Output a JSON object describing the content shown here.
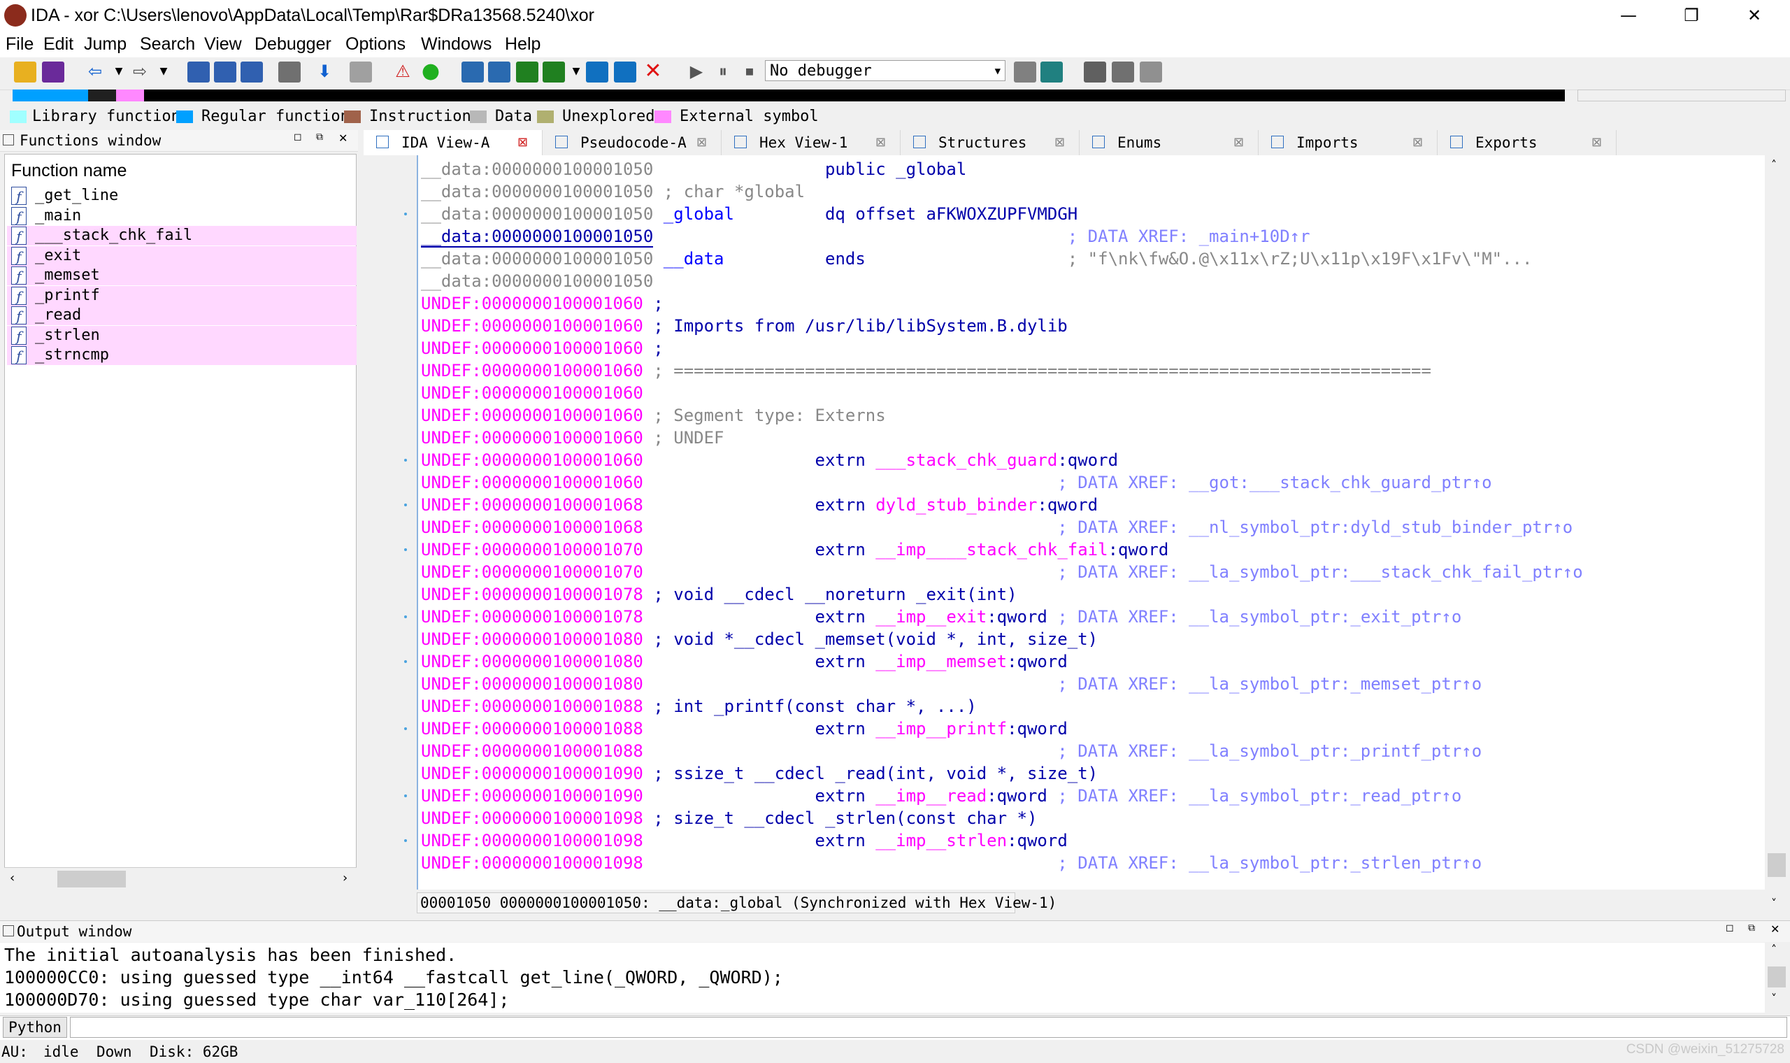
{
  "window": {
    "title": "IDA - xor C:\\Users\\lenovo\\AppData\\Local\\Temp\\Rar$DRa13568.5240\\xor",
    "minimize": "—",
    "maximize": "❐",
    "close": "✕"
  },
  "menu": [
    "File",
    "Edit",
    "Jump",
    "Search",
    "View",
    "Debugger",
    "Options",
    "Windows",
    "Help"
  ],
  "toolbar": {
    "debugger_label": "No debugger"
  },
  "legend": [
    {
      "label": "Library function",
      "color": "#a0ffff"
    },
    {
      "label": "Regular function",
      "color": "#00a0ff"
    },
    {
      "label": "Instruction",
      "color": "#a0624a"
    },
    {
      "label": "Data",
      "color": "#b8b8b8"
    },
    {
      "label": "Unexplored",
      "color": "#b0b070"
    },
    {
      "label": "External symbol",
      "color": "#ff88ff"
    }
  ],
  "functions_window": {
    "title": "Functions window",
    "column": "Function name",
    "items": [
      {
        "name": "_get_line",
        "highlight": false
      },
      {
        "name": "_main",
        "highlight": false
      },
      {
        "name": "___stack_chk_fail",
        "highlight": true
      },
      {
        "name": "_exit",
        "highlight": true
      },
      {
        "name": "_memset",
        "highlight": true
      },
      {
        "name": "_printf",
        "highlight": true
      },
      {
        "name": "_read",
        "highlight": true
      },
      {
        "name": "_strlen",
        "highlight": true
      },
      {
        "name": "_strncmp",
        "highlight": true
      }
    ]
  },
  "tabs": [
    {
      "label": "IDA View-A",
      "active": true
    },
    {
      "label": "Pseudocode-A",
      "active": false
    },
    {
      "label": "Hex View-1",
      "active": false
    },
    {
      "label": "Structures",
      "active": false
    },
    {
      "label": "Enums",
      "active": false
    },
    {
      "label": "Imports",
      "active": false
    },
    {
      "label": "Exports",
      "active": false
    }
  ],
  "disasm": [
    {
      "dot": false,
      "parts": [
        [
          "__data:0000000100001050",
          "gray"
        ],
        [
          "                 public _global",
          "navy"
        ]
      ]
    },
    {
      "dot": false,
      "parts": [
        [
          "__data:0000000100001050",
          "gray"
        ],
        [
          " ; char *global",
          "comment"
        ]
      ]
    },
    {
      "dot": true,
      "parts": [
        [
          "__data:0000000100001050",
          "gray"
        ],
        [
          " _global",
          "blue"
        ],
        [
          "         dq offset aFKWOXZUPFVMDGH",
          "navy"
        ]
      ]
    },
    {
      "dot": false,
      "parts": [
        [
          "__data:0000000100001050",
          "navy"
        ],
        [
          "                                         ; DATA XREF: _main+10D↑r",
          "xref"
        ]
      ]
    },
    {
      "dot": false,
      "parts": [
        [
          "__data:0000000100001050",
          "gray"
        ],
        [
          " __data",
          "blue"
        ],
        [
          "          ends",
          "navy"
        ],
        [
          "                    ; \"f\\nk\\fw&O.@\\x11x\\rZ;U\\x11p\\x19F\\x1Fv\\\"M\"...",
          "comment"
        ]
      ]
    },
    {
      "dot": false,
      "parts": [
        [
          "__data:0000000100001050",
          "gray"
        ]
      ]
    },
    {
      "dot": false,
      "parts": [
        [
          "UNDEF:0000000100001060",
          "magenta"
        ],
        [
          " ;",
          "navy"
        ]
      ]
    },
    {
      "dot": false,
      "parts": [
        [
          "UNDEF:0000000100001060",
          "magenta"
        ],
        [
          " ; Imports from /usr/lib/libSystem.B.dylib",
          "navy"
        ]
      ]
    },
    {
      "dot": false,
      "parts": [
        [
          "UNDEF:0000000100001060",
          "magenta"
        ],
        [
          " ;",
          "navy"
        ]
      ]
    },
    {
      "dot": false,
      "parts": [
        [
          "UNDEF:0000000100001060",
          "magenta"
        ],
        [
          " ; ===========================================================================",
          "comment"
        ]
      ]
    },
    {
      "dot": false,
      "parts": [
        [
          "UNDEF:0000000100001060",
          "magenta"
        ]
      ]
    },
    {
      "dot": false,
      "parts": [
        [
          "UNDEF:0000000100001060",
          "magenta"
        ],
        [
          " ; Segment type: Externs",
          "comment"
        ]
      ]
    },
    {
      "dot": false,
      "parts": [
        [
          "UNDEF:0000000100001060",
          "magenta"
        ],
        [
          " ; UNDEF",
          "comment"
        ]
      ]
    },
    {
      "dot": true,
      "parts": [
        [
          "UNDEF:0000000100001060",
          "magenta"
        ],
        [
          "                 extrn ",
          "navy"
        ],
        [
          "___stack_chk_guard",
          "magenta"
        ],
        [
          ":qword",
          "navy"
        ]
      ]
    },
    {
      "dot": false,
      "parts": [
        [
          "UNDEF:0000000100001060",
          "magenta"
        ],
        [
          "                                         ; DATA XREF: __got:___stack_chk_guard_ptr↑o",
          "xref"
        ]
      ]
    },
    {
      "dot": true,
      "parts": [
        [
          "UNDEF:0000000100001068",
          "magenta"
        ],
        [
          "                 extrn ",
          "navy"
        ],
        [
          "dyld_stub_binder",
          "magenta"
        ],
        [
          ":qword",
          "navy"
        ]
      ]
    },
    {
      "dot": false,
      "parts": [
        [
          "UNDEF:0000000100001068",
          "magenta"
        ],
        [
          "                                         ; DATA XREF: __nl_symbol_ptr:dyld_stub_binder_ptr↑o",
          "xref"
        ]
      ]
    },
    {
      "dot": true,
      "parts": [
        [
          "UNDEF:0000000100001070",
          "magenta"
        ],
        [
          "                 extrn ",
          "navy"
        ],
        [
          "__imp____stack_chk_fail",
          "magenta"
        ],
        [
          ":qword",
          "navy"
        ]
      ]
    },
    {
      "dot": false,
      "parts": [
        [
          "UNDEF:0000000100001070",
          "magenta"
        ],
        [
          "                                         ; DATA XREF: __la_symbol_ptr:___stack_chk_fail_ptr↑o",
          "xref"
        ]
      ]
    },
    {
      "dot": false,
      "parts": [
        [
          "UNDEF:0000000100001078",
          "magenta"
        ],
        [
          " ; void __cdecl __noreturn _exit(int)",
          "navy"
        ]
      ]
    },
    {
      "dot": true,
      "parts": [
        [
          "UNDEF:0000000100001078",
          "magenta"
        ],
        [
          "                 extrn ",
          "navy"
        ],
        [
          "__imp__exit",
          "magenta"
        ],
        [
          ":qword",
          "navy"
        ],
        [
          " ; DATA XREF: __la_symbol_ptr:_exit_ptr↑o",
          "xref"
        ]
      ]
    },
    {
      "dot": false,
      "parts": [
        [
          "UNDEF:0000000100001080",
          "magenta"
        ],
        [
          " ; void *__cdecl _memset(void *, int, size_t)",
          "navy"
        ]
      ]
    },
    {
      "dot": true,
      "parts": [
        [
          "UNDEF:0000000100001080",
          "magenta"
        ],
        [
          "                 extrn ",
          "navy"
        ],
        [
          "__imp__memset",
          "magenta"
        ],
        [
          ":qword",
          "navy"
        ]
      ]
    },
    {
      "dot": false,
      "parts": [
        [
          "UNDEF:0000000100001080",
          "magenta"
        ],
        [
          "                                         ; DATA XREF: __la_symbol_ptr:_memset_ptr↑o",
          "xref"
        ]
      ]
    },
    {
      "dot": false,
      "parts": [
        [
          "UNDEF:0000000100001088",
          "magenta"
        ],
        [
          " ; int _printf(const char *, ...)",
          "navy"
        ]
      ]
    },
    {
      "dot": true,
      "parts": [
        [
          "UNDEF:0000000100001088",
          "magenta"
        ],
        [
          "                 extrn ",
          "navy"
        ],
        [
          "__imp__printf",
          "magenta"
        ],
        [
          ":qword",
          "navy"
        ]
      ]
    },
    {
      "dot": false,
      "parts": [
        [
          "UNDEF:0000000100001088",
          "magenta"
        ],
        [
          "                                         ; DATA XREF: __la_symbol_ptr:_printf_ptr↑o",
          "xref"
        ]
      ]
    },
    {
      "dot": false,
      "parts": [
        [
          "UNDEF:0000000100001090",
          "magenta"
        ],
        [
          " ; ssize_t __cdecl _read(int, void *, size_t)",
          "navy"
        ]
      ]
    },
    {
      "dot": true,
      "parts": [
        [
          "UNDEF:0000000100001090",
          "magenta"
        ],
        [
          "                 extrn ",
          "navy"
        ],
        [
          "__imp__read",
          "magenta"
        ],
        [
          ":qword",
          "navy"
        ],
        [
          " ; DATA XREF: __la_symbol_ptr:_read_ptr↑o",
          "xref"
        ]
      ]
    },
    {
      "dot": false,
      "parts": [
        [
          "UNDEF:0000000100001098",
          "magenta"
        ],
        [
          " ; size_t __cdecl _strlen(const char *)",
          "navy"
        ]
      ]
    },
    {
      "dot": true,
      "parts": [
        [
          "UNDEF:0000000100001098",
          "magenta"
        ],
        [
          "                 extrn ",
          "navy"
        ],
        [
          "__imp__strlen",
          "magenta"
        ],
        [
          ":qword",
          "navy"
        ]
      ]
    },
    {
      "dot": false,
      "parts": [
        [
          "UNDEF:0000000100001098",
          "magenta"
        ],
        [
          "                                         ; DATA XREF: __la_symbol_ptr:_strlen_ptr↑o",
          "xref"
        ]
      ]
    }
  ],
  "disasm_status": "00001050 0000000100001050: __data:_global (Synchronized with Hex View-1)",
  "output_window": {
    "title": "Output window",
    "lines": [
      "The initial autoanalysis has been finished.",
      "100000CC0: using guessed type __int64 __fastcall get_line(_QWORD, _QWORD);",
      "100000D70: using guessed type char var_110[264];"
    ]
  },
  "python_label": "Python",
  "statusbar": {
    "au_label": "AU:",
    "au_value": "idle",
    "direction": "Down",
    "disk": "Disk: 62GB"
  },
  "watermark": "CSDN @weixin_51275728"
}
